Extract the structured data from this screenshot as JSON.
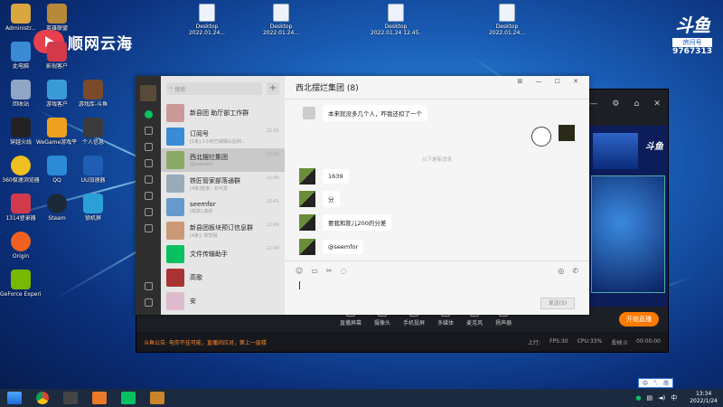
{
  "desktop": {
    "watermark_text": "顺网云海",
    "douyu": {
      "logo": "斗鱼",
      "room_label": "房间号",
      "room_id": "9767313"
    },
    "icons": [
      {
        "label": "Administr...",
        "color": "#d9a640"
      },
      {
        "label": "英雄联盟",
        "color": "#b7893a"
      },
      {
        "label": "此电脑",
        "color": "#3a8ad6"
      },
      {
        "label": "影视客户",
        "color": "#d23a4c"
      },
      {
        "label": "回收站",
        "color": "#8fa6c4"
      },
      {
        "label": "游戏客户",
        "color": "#3a9ad6"
      },
      {
        "label": "游戏库-斗鱼",
        "color": "#7a4a2a"
      },
      {
        "label": "穿越火线",
        "color": "#222"
      },
      {
        "label": "WeGame游戏平台",
        "color": "#f0a020"
      },
      {
        "label": "个人信息",
        "color": "#3a3a3a"
      },
      {
        "label": "360极速浏览器",
        "color": "#f0c020"
      },
      {
        "label": "QQ",
        "color": "#2a8ad6"
      },
      {
        "label": "UU加速器",
        "color": "#1e5fb5"
      },
      {
        "label": "1314登录器",
        "color": "#d23a4c"
      },
      {
        "label": "Steam",
        "color": "#1b2838"
      },
      {
        "label": "锁机屏",
        "color": "#2aa0d6"
      },
      {
        "label": "Origin",
        "color": "#f06020"
      },
      {
        "label": "GeForce Experience",
        "color": "#76b900"
      }
    ],
    "files": [
      {
        "name": "Desktop",
        "date": "2022.01.24..."
      },
      {
        "name": "Desktop",
        "date": "2022.01.24..."
      },
      {
        "name": "Desktop",
        "date": "2022.01.24 12.45.40.03"
      },
      {
        "name": "Desktop",
        "date": "2022.01.24..."
      }
    ]
  },
  "wechat": {
    "search_placeholder": "搜索",
    "title": "西北摆烂集团 (8)",
    "chats": [
      {
        "name": "新县团 助厅部工作群",
        "preview": "",
        "time": ""
      },
      {
        "name": "订阅号",
        "preview": "[1条] 2小时已做确认后到...",
        "time": "12:55"
      },
      {
        "name": "西北摆烂集团",
        "preview": "@seemfor",
        "time": "12:59",
        "selected": true
      },
      {
        "name": "铁匠管家部落通群",
        "preview": "[4条]管家：好可爱",
        "time": "12:40"
      },
      {
        "name": "seemfor",
        "preview": "[收款] 来的",
        "time": "12:41"
      },
      {
        "name": "新县团板块预订信息群",
        "preview": "[4条]: 你觉得",
        "time": "12:49"
      },
      {
        "name": "文件传输助手",
        "preview": "",
        "time": "12:49"
      },
      {
        "name": "高歌",
        "preview": "",
        "time": ""
      },
      {
        "name": "安",
        "preview": "",
        "time": ""
      }
    ],
    "messages": [
      {
        "text": "本来就没多几个人，咋我还扣了一个"
      },
      {
        "text": "1639"
      },
      {
        "text": "分"
      },
      {
        "text": "要我和陈儿200的分差"
      },
      {
        "text": "@seemfor"
      }
    ],
    "timestamp": "以下是新消息",
    "send_label": "发送(S)"
  },
  "streamer": {
    "bottom_items": [
      "直播屏幕",
      "摄像头",
      "手机投屏",
      "多媒体",
      "麦克风",
      "扬声器"
    ],
    "go_live": "开始直播",
    "notice": "斗鱼公告: 电你不挂可能，直播间应对，第上一层楼",
    "stats": [
      "上行:",
      "FPS:30",
      "CPU:33%",
      "丢帧:0",
      "00:00:00"
    ],
    "preview_logo": "斗鱼"
  },
  "taskbar": {
    "time": "13:34",
    "date": "2022/1/24",
    "ime": [
      "中",
      "°,",
      "简"
    ]
  }
}
